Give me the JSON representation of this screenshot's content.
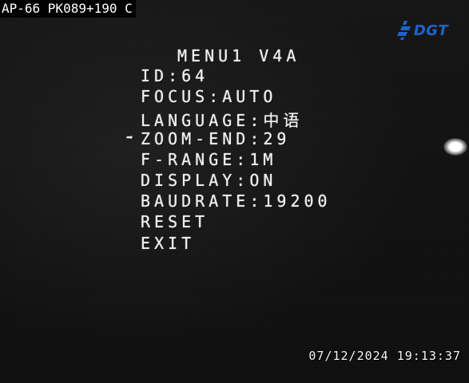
{
  "camera_label": "AP-66 PK089+190 C",
  "logo": {
    "text": "DGT",
    "icon": "dgt-logo-mark",
    "color": "#1e64c8"
  },
  "menu": {
    "title": "MENU1 V4A",
    "selected_index": 3,
    "arrow_icon": "➡",
    "items": [
      {
        "label": "ID:64"
      },
      {
        "label": "FOCUS:AUTO"
      },
      {
        "label": "LANGUAGE:中语"
      },
      {
        "label": "ZOOM-END:29"
      },
      {
        "label": "F-RANGE:1M"
      },
      {
        "label": "DISPLAY:ON"
      },
      {
        "label": "BAUDRATE:19200"
      },
      {
        "label": "RESET"
      },
      {
        "label": "EXIT"
      }
    ]
  },
  "timestamp": "07/12/2024 19:13:37"
}
